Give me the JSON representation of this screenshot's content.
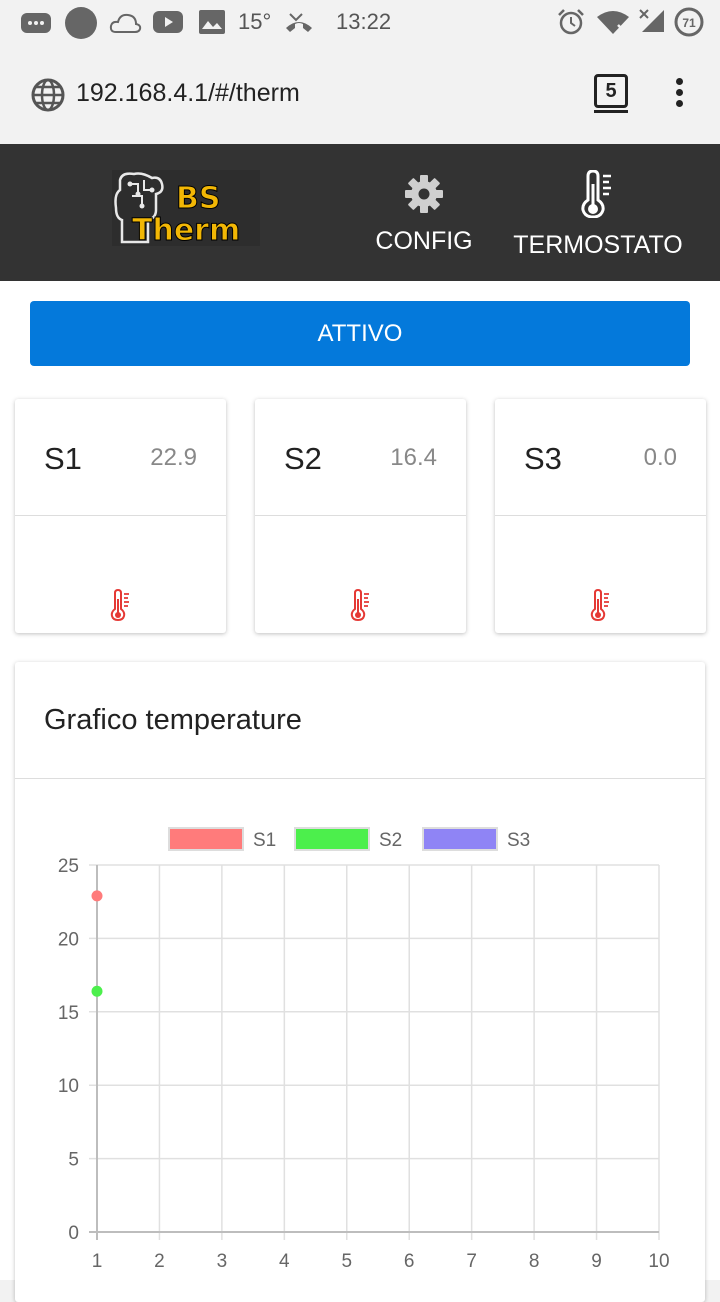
{
  "status_bar": {
    "temperature": "15°",
    "time": "13:22",
    "battery": "71"
  },
  "browser": {
    "url": "192.168.4.1/#/therm",
    "tab_count": "5"
  },
  "nav": {
    "logo_line1": "BS",
    "logo_line2": "Therm",
    "config_label": "CONFIG",
    "termostato_label": "TERMOSTATO"
  },
  "state_button": "ATTIVO",
  "sensors": [
    {
      "name": "S1",
      "value": "22.9"
    },
    {
      "name": "S2",
      "value": "16.4"
    },
    {
      "name": "S3",
      "value": "0.0"
    }
  ],
  "chart_title": "Grafico temperature",
  "colors": {
    "accent": "#0479db",
    "navbar": "#333333",
    "thermo_icon": "#e53935",
    "s1": "#ff7b7b",
    "s2": "#4cef4c",
    "s3": "#8f84f5"
  },
  "chart_data": {
    "type": "line",
    "title": "",
    "xlabel": "",
    "ylabel": "",
    "x": [
      1,
      2,
      3,
      4,
      5,
      6,
      7,
      8,
      9,
      10
    ],
    "xlim": [
      1,
      10
    ],
    "ylim": [
      0,
      25
    ],
    "yticks": [
      0,
      5,
      10,
      15,
      20,
      25
    ],
    "grid": true,
    "legend_position": "top",
    "series": [
      {
        "name": "S1",
        "color": "#ff7b7b",
        "points": [
          [
            1,
            22.9
          ]
        ]
      },
      {
        "name": "S2",
        "color": "#4cef4c",
        "points": [
          [
            1,
            16.4
          ]
        ]
      },
      {
        "name": "S3",
        "color": "#8f84f5",
        "points": []
      }
    ]
  }
}
